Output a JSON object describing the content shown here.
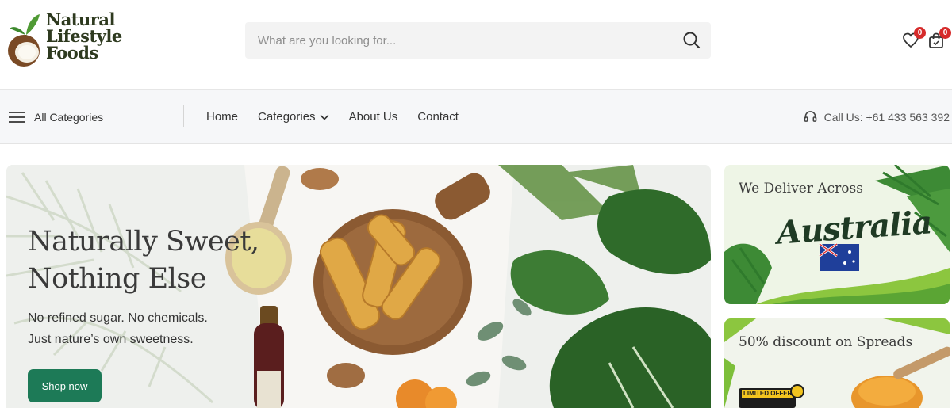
{
  "brand": {
    "line1": "Natural",
    "line2": "Lifestyle",
    "line3": "Foods",
    "logo_icon": "coconut-sprout-logo"
  },
  "search": {
    "placeholder": "What are you looking for...",
    "value": "",
    "icon": "search-icon"
  },
  "header_icons": {
    "wishlist_count": "0",
    "cart_count": "0"
  },
  "nav": {
    "all_categories": "All Categories",
    "links": [
      {
        "label": "Home"
      },
      {
        "label": "Categories"
      },
      {
        "label": "About Us"
      },
      {
        "label": "Contact"
      }
    ],
    "call": "Call Us: +61 433 563 392"
  },
  "hero": {
    "title_line1": "Naturally Sweet,",
    "title_line2": "Nothing Else",
    "sub_line1": "No refined sugar. No chemicals.",
    "sub_line2": "Just nature’s own sweetness.",
    "button": "Shop now"
  },
  "promo1": {
    "heading": "We Deliver Across",
    "script_text": "Australia"
  },
  "promo2": {
    "heading": "50% discount on Spreads",
    "tag": "LIMITED OFFER"
  },
  "colors": {
    "brand_green": "#1d7a57",
    "badge_red": "#d62b2b",
    "logo_text": "#2e3a1f"
  }
}
